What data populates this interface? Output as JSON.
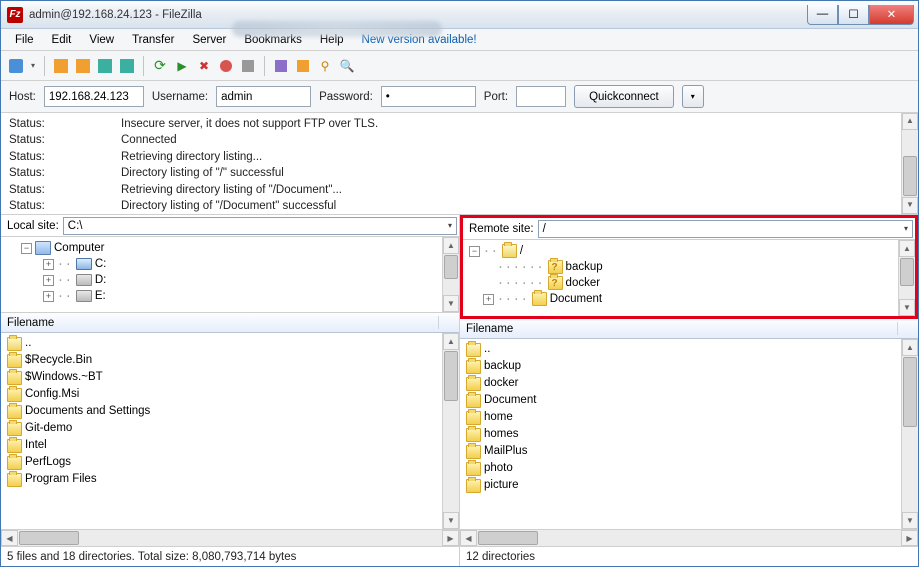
{
  "window": {
    "title": "admin@192.168.24.123 - FileZilla"
  },
  "menu": {
    "file": "File",
    "edit": "Edit",
    "view": "View",
    "transfer": "Transfer",
    "server": "Server",
    "bookmarks": "Bookmarks",
    "help": "Help",
    "new_version": "New version available!"
  },
  "quickconnect": {
    "host_label": "Host:",
    "host_value": "192.168.24.123",
    "user_label": "Username:",
    "user_value": "admin",
    "pass_label": "Password:",
    "pass_value": "•",
    "port_label": "Port:",
    "port_value": "",
    "button": "Quickconnect"
  },
  "log": {
    "label": "Status:",
    "lines": [
      "Insecure server, it does not support FTP over TLS.",
      "Connected",
      "Retrieving directory listing...",
      "Directory listing of \"/\" successful",
      "Retrieving directory listing of \"/Document\"...",
      "Directory listing of \"/Document\" successful"
    ]
  },
  "local": {
    "site_label": "Local site:",
    "site_value": "C:\\",
    "tree": {
      "root": "Computer",
      "drives": [
        "C:",
        "D:",
        "E:"
      ]
    },
    "header": "Filename",
    "items": [
      "..",
      "$Recycle.Bin",
      "$Windows.~BT",
      "Config.Msi",
      "Documents and Settings",
      "Git-demo",
      "Intel",
      "PerfLogs",
      "Program Files"
    ],
    "status": "5 files and 18 directories. Total size: 8,080,793,714 bytes"
  },
  "remote": {
    "site_label": "Remote site:",
    "site_value": "/",
    "tree": {
      "root": "/",
      "children": [
        "backup",
        "docker",
        "Document"
      ]
    },
    "header": "Filename",
    "items": [
      "..",
      "backup",
      "docker",
      "Document",
      "home",
      "homes",
      "MailPlus",
      "photo",
      "picture"
    ],
    "status": "12 directories"
  },
  "winbtn": {
    "min": "—",
    "max": "☐",
    "close": "✕"
  }
}
